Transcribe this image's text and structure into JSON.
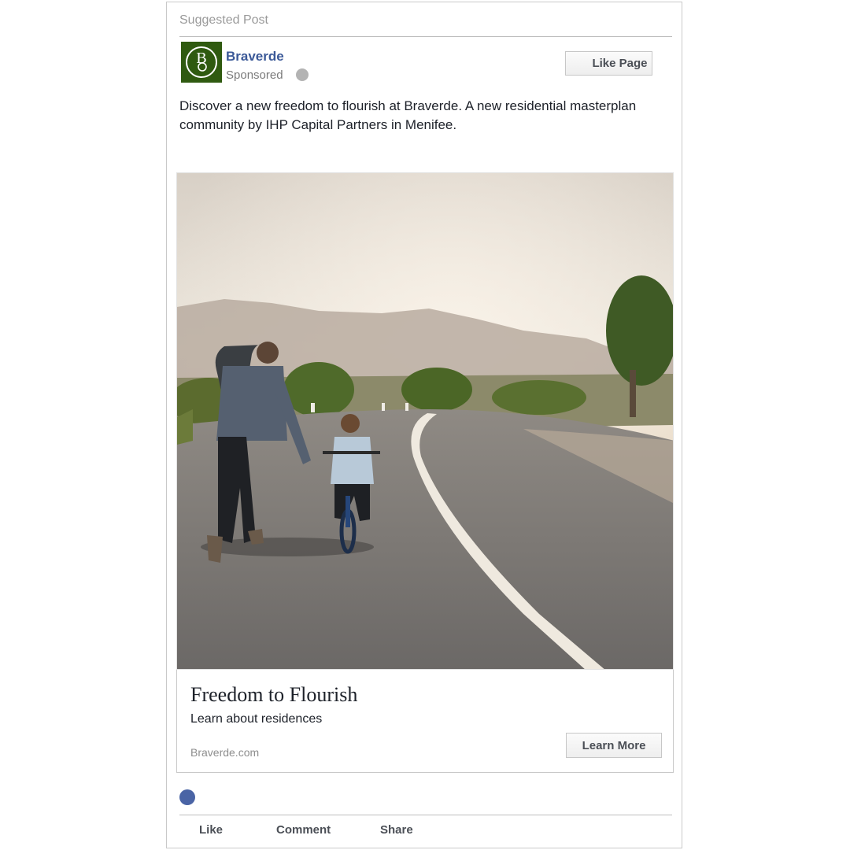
{
  "post": {
    "suggested_label": "Suggested Post",
    "page_name": "Braverde",
    "sponsored_label": "Sponsored",
    "like_page_label": "Like Page",
    "message": "Discover a new freedom to flourish at Braverde. A new residential masterplan community by IHP Capital Partners in Menifee.",
    "avatar_letter": "B",
    "avatar_color": "#2f5a10",
    "link_color": "#3b5998"
  },
  "link_preview": {
    "headline": "Freedom to Flourish",
    "description": "Learn about residences",
    "domain": "Braverde.com",
    "cta_label": "Learn More"
  },
  "actions": {
    "like": "Like",
    "comment": "Comment",
    "share": "Share"
  },
  "icons": {
    "globe": "globe-icon",
    "reaction": "like-reaction-icon"
  }
}
